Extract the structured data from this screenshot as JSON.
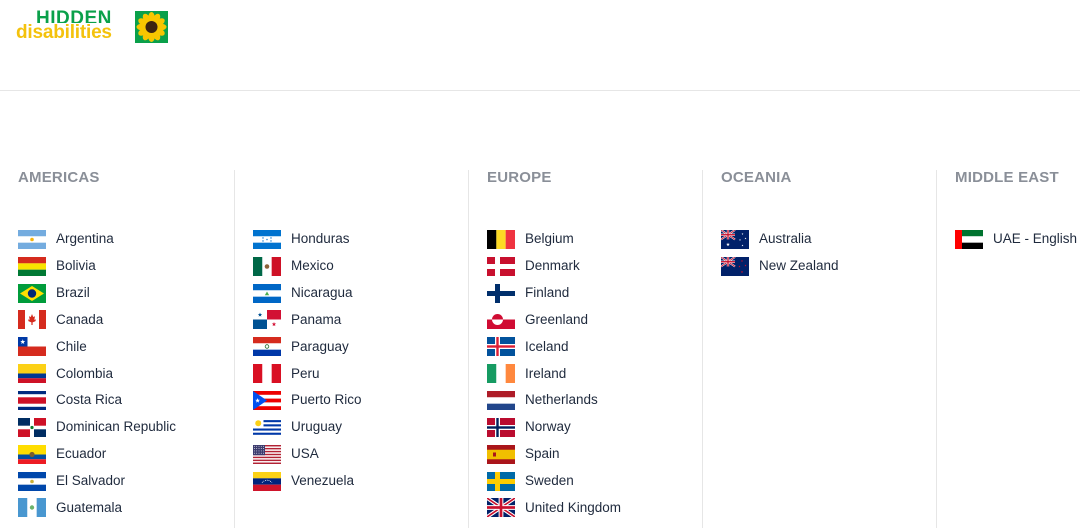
{
  "logo": {
    "line1": "HIDDEN",
    "line2": "disabilities",
    "emblem": "sunflower-icon"
  },
  "regions": [
    {
      "key": "americas-1",
      "title": "AMERICAS",
      "countries": [
        {
          "name": "Argentina",
          "flag": "argentina"
        },
        {
          "name": "Bolivia",
          "flag": "bolivia"
        },
        {
          "name": "Brazil",
          "flag": "brazil"
        },
        {
          "name": "Canada",
          "flag": "canada"
        },
        {
          "name": "Chile",
          "flag": "chile"
        },
        {
          "name": "Colombia",
          "flag": "colombia"
        },
        {
          "name": "Costa Rica",
          "flag": "costa-rica"
        },
        {
          "name": "Dominican Republic",
          "flag": "dominican-republic"
        },
        {
          "name": "Ecuador",
          "flag": "ecuador"
        },
        {
          "name": "El Salvador",
          "flag": "el-salvador"
        },
        {
          "name": "Guatemala",
          "flag": "guatemala"
        }
      ]
    },
    {
      "key": "americas-2",
      "title": "",
      "countries": [
        {
          "name": "Honduras",
          "flag": "honduras"
        },
        {
          "name": "Mexico",
          "flag": "mexico"
        },
        {
          "name": "Nicaragua",
          "flag": "nicaragua"
        },
        {
          "name": "Panama",
          "flag": "panama"
        },
        {
          "name": "Paraguay",
          "flag": "paraguay"
        },
        {
          "name": "Peru",
          "flag": "peru"
        },
        {
          "name": "Puerto Rico",
          "flag": "puerto-rico"
        },
        {
          "name": "Uruguay",
          "flag": "uruguay"
        },
        {
          "name": "USA",
          "flag": "usa"
        },
        {
          "name": "Venezuela",
          "flag": "venezuela"
        }
      ]
    },
    {
      "key": "europe",
      "title": "EUROPE",
      "countries": [
        {
          "name": "Belgium",
          "flag": "belgium"
        },
        {
          "name": "Denmark",
          "flag": "denmark"
        },
        {
          "name": "Finland",
          "flag": "finland"
        },
        {
          "name": "Greenland",
          "flag": "greenland"
        },
        {
          "name": "Iceland",
          "flag": "iceland"
        },
        {
          "name": "Ireland",
          "flag": "ireland"
        },
        {
          "name": "Netherlands",
          "flag": "netherlands"
        },
        {
          "name": "Norway",
          "flag": "norway"
        },
        {
          "name": "Spain",
          "flag": "spain"
        },
        {
          "name": "Sweden",
          "flag": "sweden"
        },
        {
          "name": "United Kingdom",
          "flag": "united-kingdom"
        }
      ]
    },
    {
      "key": "oceania",
      "title": "OCEANIA",
      "countries": [
        {
          "name": "Australia",
          "flag": "australia"
        },
        {
          "name": "New Zealand",
          "flag": "new-zealand"
        }
      ]
    },
    {
      "key": "middle-east",
      "title": "MIDDLE EAST",
      "countries": [
        {
          "name": "UAE - English",
          "flag": "uae"
        }
      ]
    }
  ]
}
